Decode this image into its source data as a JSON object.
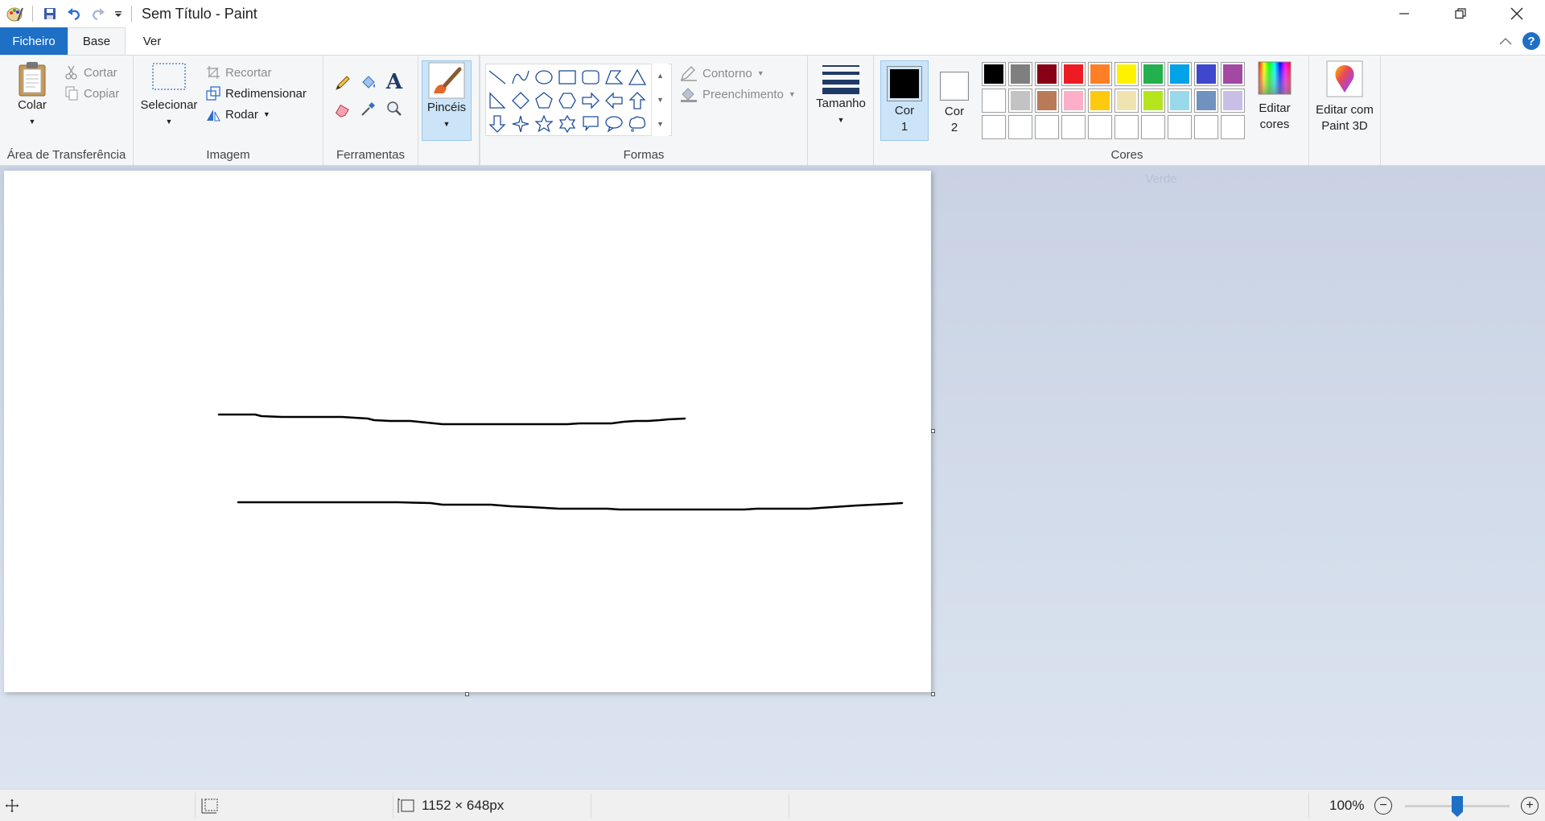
{
  "window": {
    "title": "Sem Título - Paint"
  },
  "tabs": {
    "file": "Ficheiro",
    "home": "Base",
    "view": "Ver"
  },
  "clipboard": {
    "paste": "Colar",
    "cut": "Cortar",
    "copy": "Copiar",
    "label": "Área de Transferência"
  },
  "image": {
    "select": "Selecionar",
    "crop": "Recortar",
    "resize": "Redimensionar",
    "rotate": "Rodar",
    "label": "Imagem"
  },
  "tools": {
    "label": "Ferramentas"
  },
  "brushes": {
    "label": "Pincéis"
  },
  "shapes": {
    "outline": "Contorno",
    "fill": "Preenchimento",
    "label": "Formas"
  },
  "size": {
    "label": "Tamanho"
  },
  "colors": {
    "color1_line1": "Cor",
    "color1_line2": "1",
    "color2_line1": "Cor",
    "color2_line2": "2",
    "color1_value": "#000000",
    "color2_value": "#ffffff",
    "edit_line1": "Editar",
    "edit_line2": "cores",
    "label": "Cores",
    "row1": [
      "#000000",
      "#7f7f7f",
      "#880015",
      "#ed1c24",
      "#ff7f27",
      "#fff200",
      "#22b14c",
      "#00a2e8",
      "#3f48cc",
      "#a349a4"
    ],
    "row2": [
      "#ffffff",
      "#c3c3c3",
      "#b97a57",
      "#ffaec9",
      "#ffc90e",
      "#efe4b0",
      "#b5e61d",
      "#99d9ea",
      "#7092be",
      "#c8bfe7"
    ],
    "row3": [
      "#ffffff",
      "#ffffff",
      "#ffffff",
      "#ffffff",
      "#ffffff",
      "#ffffff",
      "#ffffff",
      "#ffffff",
      "#ffffff",
      "#ffffff"
    ]
  },
  "paint3d": {
    "line1": "Editar com",
    "line2": "Paint 3D"
  },
  "tooltip": {
    "text": "Verde"
  },
  "status": {
    "dimensions": "1152 × 648px",
    "zoom": "100%",
    "zoom_fraction": 0.5
  }
}
